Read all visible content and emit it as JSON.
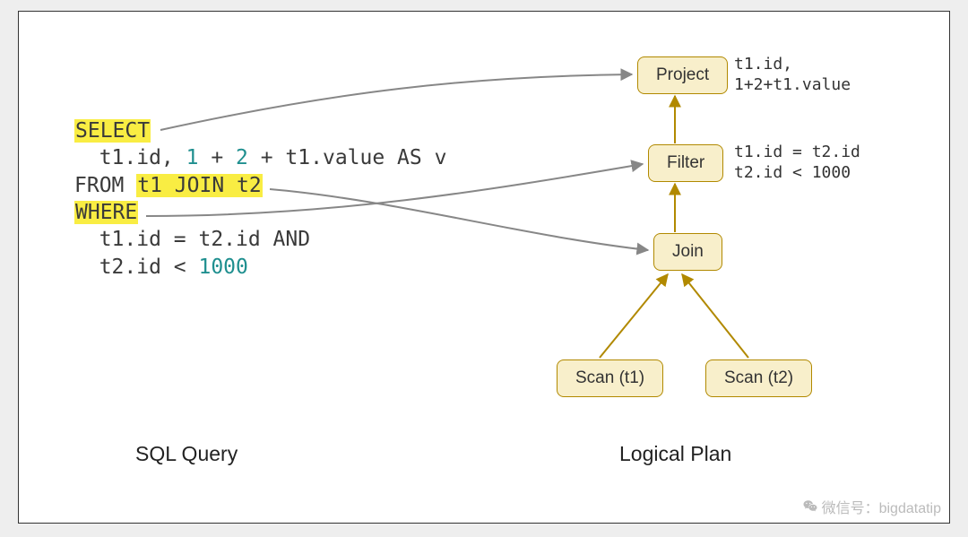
{
  "sql": {
    "kw_select": "SELECT",
    "select_line_pre": "  t1.id, ",
    "select_one": "1",
    "select_plus1": " + ",
    "select_two": "2",
    "select_rest": " + t1.value AS v",
    "from_kw": "FROM ",
    "from_join": "t1 JOIN t2",
    "kw_where": "WHERE",
    "where_line1": "  t1.id = t2.id AND",
    "where_line2_pre": "  t2.id < ",
    "where_1000": "1000"
  },
  "plan": {
    "project": {
      "label": "Project",
      "detail": "t1.id,\n1+2+t1.value"
    },
    "filter": {
      "label": "Filter",
      "detail": "t1.id = t2.id\nt2.id < 1000"
    },
    "join": {
      "label": "Join"
    },
    "scan_t1": {
      "label": "Scan (t1)"
    },
    "scan_t2": {
      "label": "Scan (t2)"
    }
  },
  "captions": {
    "sql": "SQL Query",
    "plan": "Logical Plan"
  },
  "watermark": {
    "text": "微信号：bigdatatip"
  },
  "colors": {
    "highlight": "#f9ed43",
    "node_fill": "#f8efcb",
    "node_border": "#b18900",
    "arrow_gray": "#878787",
    "arrow_gold": "#b18900",
    "numeric": "#1f8f8f"
  }
}
